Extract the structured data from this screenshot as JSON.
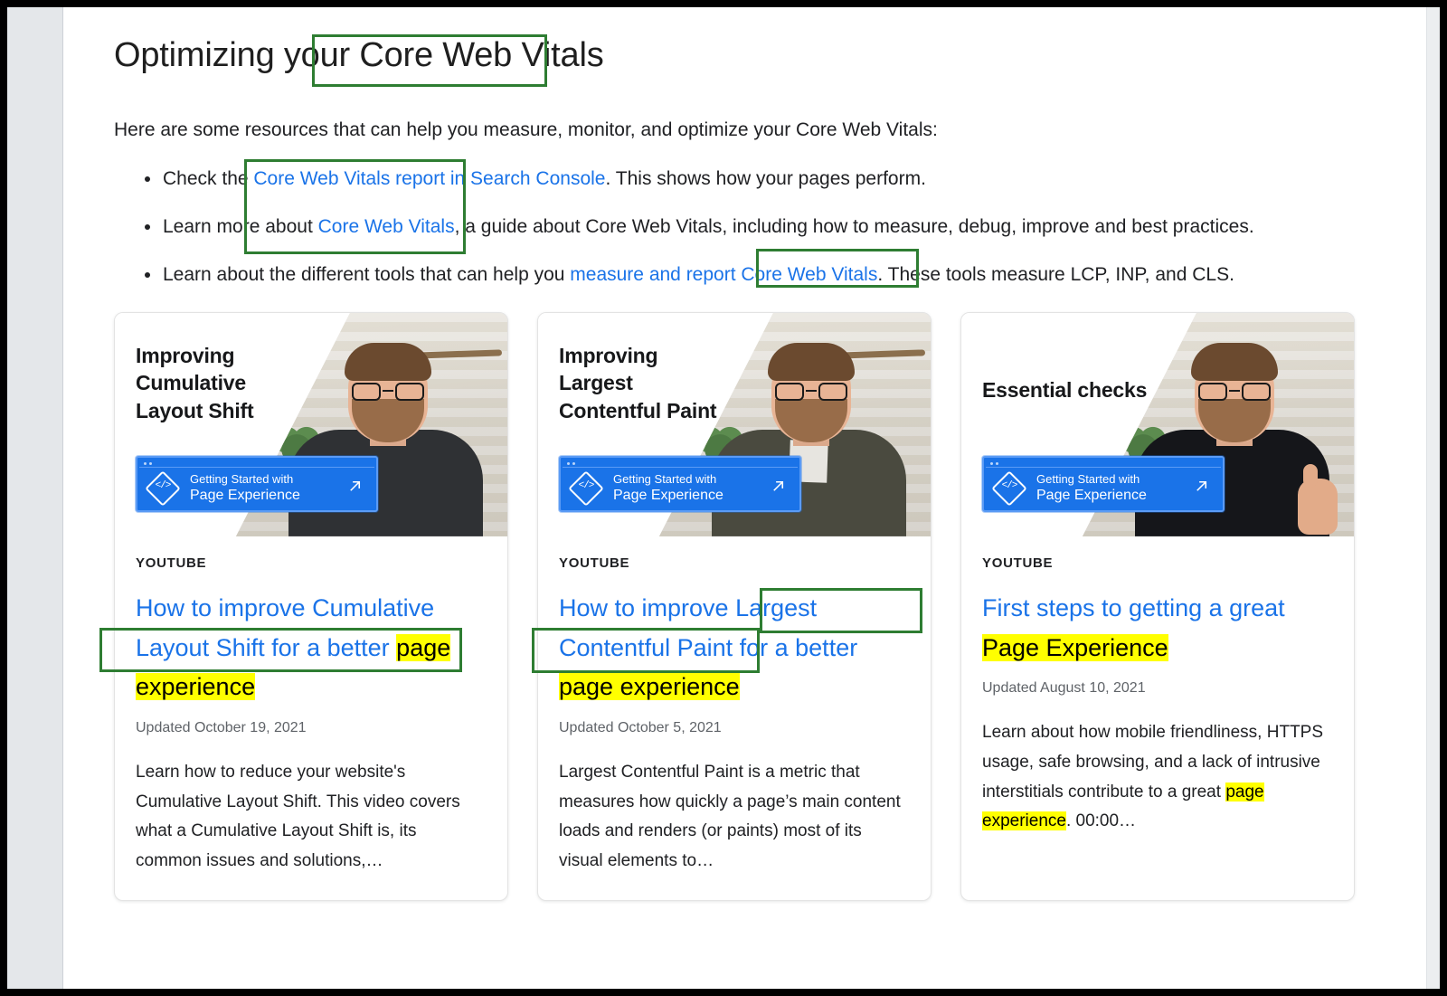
{
  "page": {
    "title_prefix": "Optimizing your ",
    "title_highlight": "Core Web Vitals",
    "intro": "Here are some resources that can help you measure, monitor, and optimize your Core Web Vitals:"
  },
  "bullets": [
    {
      "pre": "Check the ",
      "link": "Core Web Vitals report in Search Console",
      "post": ". This shows how your pages perform."
    },
    {
      "pre": "Learn more about ",
      "link": "Core Web Vitals",
      "post": ", a guide about Core Web Vitals, including how to measure, debug, improve and best practices."
    },
    {
      "pre": "Learn about the different tools that can help you ",
      "link": "measure and report Core Web Vitals",
      "post": ". These tools measure LCP, INP, and CLS."
    }
  ],
  "cards": [
    {
      "thumb_title": "Improving\nCumulative\nLayout Shift",
      "banner_line1": "Getting Started with",
      "banner_line2": "Page Experience",
      "source": "YOUTUBE",
      "title_parts": [
        {
          "text": "How to improve ",
          "style": "link"
        },
        {
          "text": "Cumulative Layout Shift",
          "style": "link"
        },
        {
          "text": " for a better ",
          "style": "link"
        },
        {
          "text": "page experience",
          "style": "highlight"
        }
      ],
      "updated": "Updated October 19, 2021",
      "description": "Learn how to reduce your website's Cumulative Layout Shift. This video covers what a Cumulative Layout Shift is, its common issues and solutions,…"
    },
    {
      "thumb_title": "Improving\nLargest\nContentful Paint",
      "banner_line1": "Getting Started with",
      "banner_line2": "Page Experience",
      "source": "YOUTUBE",
      "title_parts": [
        {
          "text": "How to improve ",
          "style": "link"
        },
        {
          "text": "Largest Contentful Paint",
          "style": "link"
        },
        {
          "text": " for a better ",
          "style": "link"
        },
        {
          "text": "page experience",
          "style": "highlight"
        }
      ],
      "updated": "Updated October 5, 2021",
      "description": "Largest Contentful Paint is a metric that measures how quickly a page’s main content loads and renders (or paints) most of its visual elements to…"
    },
    {
      "thumb_title": "Essential checks",
      "banner_line1": "Getting Started with",
      "banner_line2": "Page Experience",
      "source": "YOUTUBE",
      "title_parts": [
        {
          "text": "First steps to getting a great ",
          "style": "link"
        },
        {
          "text": "Page Experience",
          "style": "highlight"
        }
      ],
      "updated": "Updated August 10, 2021",
      "description_pre": "Learn about how mobile friendliness, HTTPS usage, safe browsing, and a lack of intrusive interstitials contribute to a great ",
      "description_hl": "page experience",
      "description_post": ". 00:00…"
    }
  ],
  "colors": {
    "link": "#1a73e8",
    "annotation_box": "#2e7d32",
    "highlight": "#ffff00",
    "text": "#202124"
  }
}
